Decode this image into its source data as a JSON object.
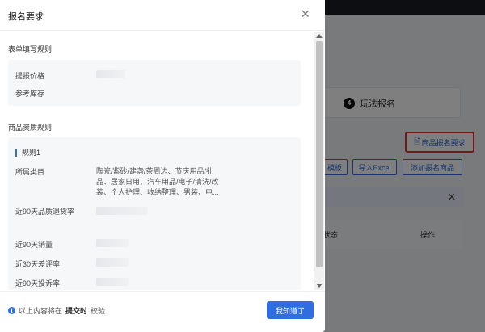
{
  "background": {
    "step": {
      "number": "4",
      "label": "玩法报名"
    },
    "requirements_link": "商品报名要求",
    "buttons": {
      "template": "模板",
      "import_excel": "导入Excel",
      "add_product": "添加报名商品"
    },
    "notice_close": "✕",
    "table_headers": {
      "status": "状态",
      "actions": "操作"
    }
  },
  "modal": {
    "title": "报名要求",
    "close_icon": "✕",
    "form_rules": {
      "title": "表单填写规则",
      "rows": [
        {
          "label": "提报价格"
        },
        {
          "label": "参考库存"
        }
      ]
    },
    "qualification_rules": {
      "title": "商品资质规则",
      "rule_name": "规则1",
      "category_label": "所属类目",
      "category_value": "陶瓷/紫砂/建盏/茶周边、节庆用品/礼品、居家日用、汽车用品/电子/清洗/改装、个人护理、收纳整理、男装、电...",
      "metrics": [
        "近90天品质退货率",
        "近90天销量",
        "近30天差评率",
        "近90天投诉率"
      ]
    },
    "footer": {
      "info_prefix": "以上内容将在",
      "info_bold": "提交时",
      "info_suffix": "校验",
      "ok_button": "我知道了"
    }
  },
  "colors": {
    "primary": "#2f6de0",
    "highlight": "#e0342e"
  }
}
